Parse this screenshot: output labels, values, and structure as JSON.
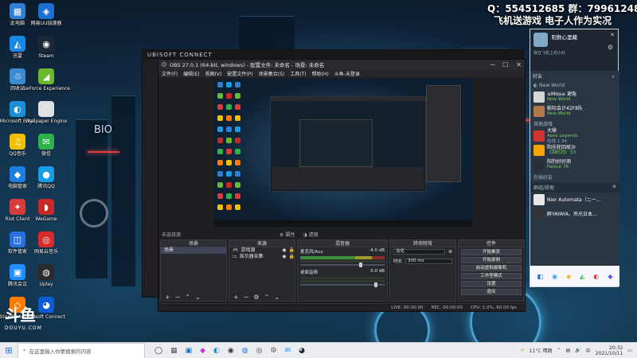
{
  "overlay": {
    "qq": "Q：554512685 群：799612489",
    "line2": "飞机送游戏 电子人作为实况",
    "bio": "BIO"
  },
  "desktop_icons": [
    {
      "label": "此电脑",
      "color": "#2f80d5",
      "glyph": "▦"
    },
    {
      "label": "网易UU加速器",
      "color": "#1a6fd0",
      "glyph": "◈"
    },
    {
      "label": "迅雷",
      "color": "#1989e5",
      "glyph": "◭"
    },
    {
      "label": "Steam",
      "color": "#1b2838",
      "glyph": "◉"
    },
    {
      "label": "回收站",
      "color": "#3a8bd1",
      "glyph": "♲"
    },
    {
      "label": "GeForce Experience",
      "color": "#69b82e",
      "glyph": "◢"
    },
    {
      "label": "Microsoft Edge",
      "color": "#1b8fd6",
      "glyph": "◐"
    },
    {
      "label": "Wallpaper Engine",
      "color": "#e0e0e0",
      "glyph": "◌"
    },
    {
      "label": "QQ音乐",
      "color": "#f0c000",
      "glyph": "♫"
    },
    {
      "label": "微信",
      "color": "#2db34a",
      "glyph": "✉"
    },
    {
      "label": "电脑管家",
      "color": "#1e7fe0",
      "glyph": "◆"
    },
    {
      "label": "腾讯QQ",
      "color": "#1a9ce5",
      "glyph": "●"
    },
    {
      "label": "Riot Client",
      "color": "#d93b3b",
      "glyph": "✦"
    },
    {
      "label": "WeGame",
      "color": "#c82828",
      "glyph": "◗"
    },
    {
      "label": "软件管家",
      "color": "#2a6fe0",
      "glyph": "◫"
    },
    {
      "label": "网易云音乐",
      "color": "#d82b2b",
      "glyph": "◎"
    },
    {
      "label": "腾讯会议",
      "color": "#1f8fff",
      "glyph": "▣"
    },
    {
      "label": "Uplay",
      "color": "#2a2a2a",
      "glyph": "◍"
    },
    {
      "label": "SteelSeries GG",
      "color": "#ff7a00",
      "glyph": "◇"
    },
    {
      "label": "Ubisoft Connect",
      "color": "#0d5bd6",
      "glyph": "◕"
    }
  ],
  "brand": {
    "big": "斗鱼",
    "small": "DOUYU.COM"
  },
  "ubisoft": {
    "title": "UBISOFT CONNECT"
  },
  "obs": {
    "title": "OBS 27.0.1 (64-bit, windows) - 配置文件: 未命名 - 场景: 未命名",
    "menu": [
      "文件(F)",
      "编辑(E)",
      "视图(V)",
      "配置文件(P)",
      "场景集合(S)",
      "工具(T)",
      "帮助(H)",
      "斗鱼-未登录"
    ],
    "tools_left": "未选择源",
    "tools_mid": [
      "属性",
      "滤镜"
    ],
    "docks": {
      "scenes": {
        "title": "场景",
        "items": [
          "场景"
        ]
      },
      "sources": {
        "title": "来源",
        "items": [
          "游戏源",
          "显示器采集"
        ]
      },
      "mixer": {
        "title": "混音器",
        "tracks": [
          {
            "name": "麦克风/Aux",
            "db": "-4.0 dB"
          },
          {
            "name": "桌面音频",
            "db": "0.0 dB"
          }
        ]
      },
      "transitions": {
        "title": "转场特效",
        "type": "淡化",
        "duration_label": "时长",
        "duration": "300 ms"
      },
      "controls": {
        "title": "控件",
        "buttons": [
          "开始推流",
          "开始录制",
          "启动虚拟摄像机",
          "工作室模式",
          "设置",
          "退出"
        ]
      }
    },
    "status": [
      "LIVE: 00:00:00",
      "REC: 00:00:00",
      "CPU: 1.0%, 60.00 fps"
    ]
  },
  "chat": {
    "name": "阳数心里藏",
    "signature": "我在飞机上的小红",
    "search_placeholder": "好友",
    "section_playing": "New World",
    "friends_playing": [
      {
        "name": "≡Miss≡ 谢兔",
        "status": "New World",
        "color": "#d8d8d8"
      },
      {
        "name": "影际会计42F8队",
        "status": "New World",
        "color": "#b07a4a"
      }
    ],
    "section_other": "其他游戏",
    "friends_other": [
      {
        "name": "大鼎",
        "status": "Apex Legends",
        "color": "#d43131",
        "extra": "在线 1.34"
      },
      {
        "name": "阳乐轮回故沙",
        "status": "《回码消》 53",
        "color": "#f6a400"
      },
      {
        "name": "阳剂好好测",
        "status": "Fallout 76",
        "color": "#2a2f3a"
      }
    ],
    "section_online": "在线好友",
    "section_group": "群组/其他",
    "friends_online": [
      {
        "name": "Nier Automata（ニー…",
        "status": "",
        "color": "#e8e8e8"
      },
      {
        "name": "醉YAYAYA，杀光日本…",
        "status": "",
        "color": "#333"
      }
    ]
  },
  "taskbar": {
    "search_placeholder": "在这里输入你要搜索的内容",
    "weather": "11°C 晴朗",
    "time": "20:32",
    "date": "2021/10/11"
  }
}
